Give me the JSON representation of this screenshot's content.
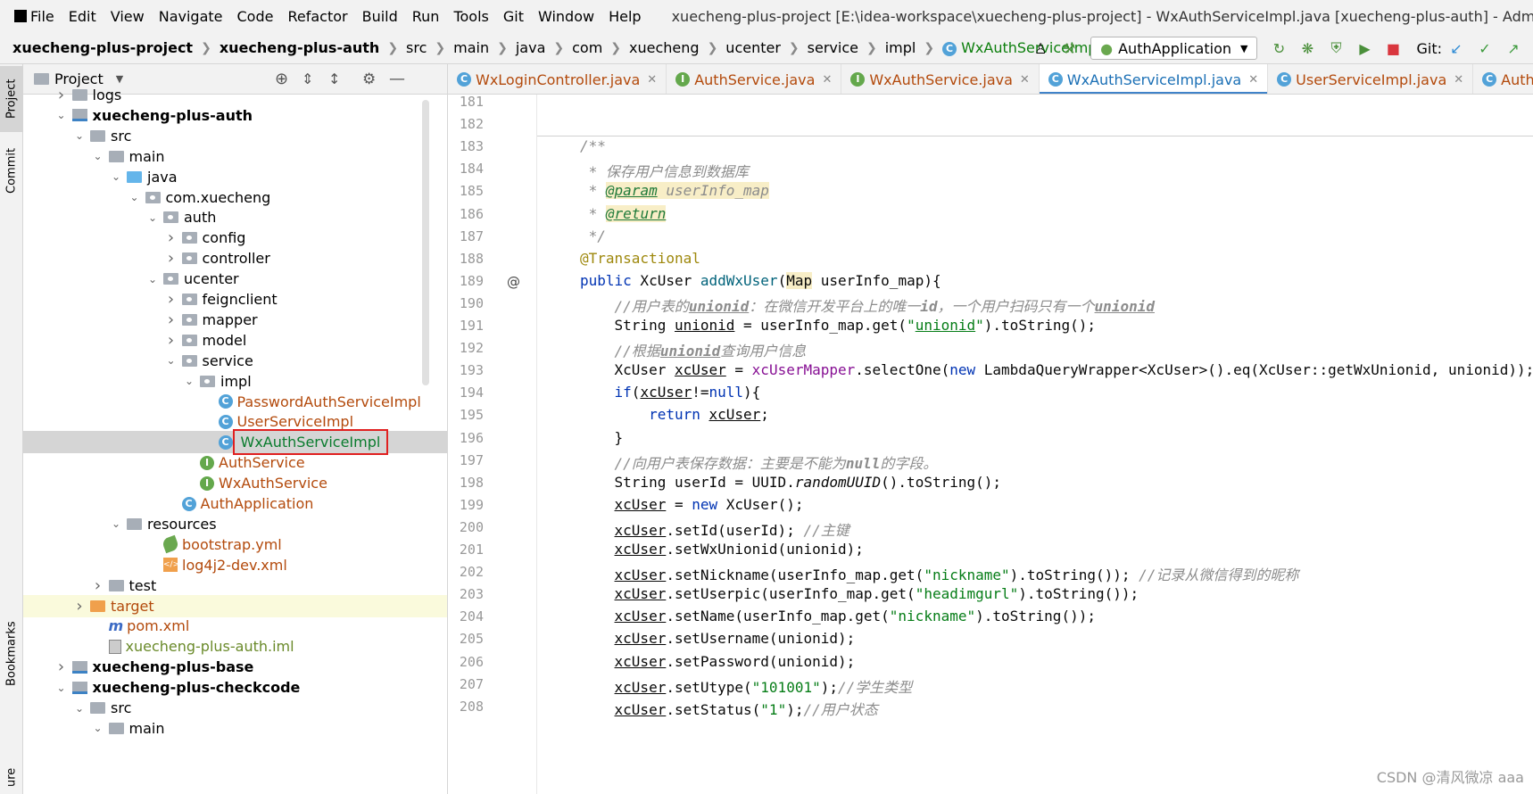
{
  "menubar": {
    "items": [
      "File",
      "Edit",
      "View",
      "Navigate",
      "Code",
      "Refactor",
      "Build",
      "Run",
      "Tools",
      "Git",
      "Window",
      "Help"
    ],
    "title": "xuecheng-plus-project [E:\\idea-workspace\\xuecheng-plus-project] - WxAuthServiceImpl.java [xuecheng-plus-auth] - Administrator"
  },
  "breadcrumb": [
    "xuecheng-plus-project",
    "xuecheng-plus-auth",
    "src",
    "main",
    "java",
    "com",
    "xuecheng",
    "ucenter",
    "service",
    "impl",
    "WxAuthServiceImpl"
  ],
  "toolbar": {
    "run_config": "AuthApplication",
    "git_label": "Git:"
  },
  "side_tabs": {
    "project": "Project",
    "commit": "Commit",
    "bookmarks": "Bookmarks",
    "structure": "ure"
  },
  "project_panel": {
    "title": "Project",
    "tree": [
      {
        "label": "logs",
        "depth": 1,
        "kind": "folder",
        "arrow": ">"
      },
      {
        "label": "xuecheng-plus-auth",
        "depth": 1,
        "kind": "module",
        "arrow": "v"
      },
      {
        "label": "src",
        "depth": 2,
        "kind": "folder",
        "arrow": "v"
      },
      {
        "label": "main",
        "depth": 3,
        "kind": "folder",
        "arrow": "v"
      },
      {
        "label": "java",
        "depth": 4,
        "kind": "srcfolder",
        "arrow": "v"
      },
      {
        "label": "com.xuecheng",
        "depth": 5,
        "kind": "package",
        "arrow": "v"
      },
      {
        "label": "auth",
        "depth": 6,
        "kind": "package",
        "arrow": "v"
      },
      {
        "label": "config",
        "depth": 7,
        "kind": "package",
        "arrow": ">"
      },
      {
        "label": "controller",
        "depth": 7,
        "kind": "package",
        "arrow": ">"
      },
      {
        "label": "ucenter",
        "depth": 6,
        "kind": "package",
        "arrow": "v"
      },
      {
        "label": "feignclient",
        "depth": 7,
        "kind": "package",
        "arrow": ">"
      },
      {
        "label": "mapper",
        "depth": 7,
        "kind": "package",
        "arrow": ">"
      },
      {
        "label": "model",
        "depth": 7,
        "kind": "package",
        "arrow": ">"
      },
      {
        "label": "service",
        "depth": 7,
        "kind": "package",
        "arrow": "v"
      },
      {
        "label": "impl",
        "depth": 8,
        "kind": "package",
        "arrow": "v"
      },
      {
        "label": "PasswordAuthServiceImpl",
        "depth": 9,
        "kind": "class"
      },
      {
        "label": "UserServiceImpl",
        "depth": 9,
        "kind": "class"
      },
      {
        "label": "WxAuthServiceImpl",
        "depth": 9,
        "kind": "class",
        "selected": true
      },
      {
        "label": "AuthService",
        "depth": 8,
        "kind": "interface"
      },
      {
        "label": "WxAuthService",
        "depth": 8,
        "kind": "interface"
      },
      {
        "label": "AuthApplication",
        "depth": 7,
        "kind": "appclass"
      },
      {
        "label": "resources",
        "depth": 4,
        "kind": "resfolder",
        "arrow": "v"
      },
      {
        "label": "bootstrap.yml",
        "depth": 6,
        "kind": "yml"
      },
      {
        "label": "log4j2-dev.xml",
        "depth": 6,
        "kind": "xml"
      },
      {
        "label": "test",
        "depth": 3,
        "kind": "folder",
        "arrow": ">"
      },
      {
        "label": "target",
        "depth": 2,
        "kind": "target",
        "arrow": ">"
      },
      {
        "label": "pom.xml",
        "depth": 3,
        "kind": "pom"
      },
      {
        "label": "xuecheng-plus-auth.iml",
        "depth": 3,
        "kind": "iml"
      },
      {
        "label": "xuecheng-plus-base",
        "depth": 1,
        "kind": "module",
        "arrow": ">"
      },
      {
        "label": "xuecheng-plus-checkcode",
        "depth": 1,
        "kind": "module",
        "arrow": "v"
      },
      {
        "label": "src",
        "depth": 2,
        "kind": "folder",
        "arrow": "v"
      },
      {
        "label": "main",
        "depth": 3,
        "kind": "folder",
        "arrow": "v"
      }
    ]
  },
  "tabs": [
    {
      "label": "WxLoginController.java",
      "kind": "class"
    },
    {
      "label": "AuthService.java",
      "kind": "interface"
    },
    {
      "label": "WxAuthService.java",
      "kind": "interface"
    },
    {
      "label": "WxAuthServiceImpl.java",
      "kind": "class",
      "active": true
    },
    {
      "label": "UserServiceImpl.java",
      "kind": "class"
    },
    {
      "label": "AuthApplication",
      "kind": "class"
    }
  ],
  "editor": {
    "lines": [
      {
        "n": "181",
        "html": ""
      },
      {
        "n": "182",
        "html": ""
      },
      {
        "n": "183",
        "html": "<span class='cm'>/**</span>"
      },
      {
        "n": "184",
        "html": "<span class='cm'> * 保存用户信息到数据库</span>"
      },
      {
        "n": "185",
        "html": "<span class='cm'> * </span><span class='tag'>@param</span><span class='cm brk'> userInfo_map</span>"
      },
      {
        "n": "186",
        "html": "<span class='cm'> * </span><span class='tag'>@return</span>"
      },
      {
        "n": "187",
        "html": "<span class='cm'> */</span>"
      },
      {
        "n": "188",
        "html": "<span class='an'>@Transactional</span>"
      },
      {
        "n": "189",
        "html": "<span class='kw'>public</span> XcUser <span class='fn'>addWxUser</span>(<span class='brk'>Map</span> userInfo_map){"
      },
      {
        "n": "190",
        "html": "    <span class='cmt'>//用户表的<b class='ul'>unionid</b>：在微信开发平台上的唯一<b>id</b>，一个用户扫码只有一个<b class='ul'>unionid</b></span>"
      },
      {
        "n": "191",
        "html": "    String <span class='ul'>unionid</span> = userInfo_map.get(<span class='str'>\"<span class='ul'>unionid</span>\"</span>).toString();"
      },
      {
        "n": "192",
        "html": "    <span class='cmt'>//根据<b class='ul'>unionid</b>查询用户信息</span>"
      },
      {
        "n": "193",
        "html": "    XcUser <span class='ul'>xcUser</span> = <span class='fld'>xcUserMapper</span>.selectOne(<span class='kw'>new</span> LambdaQueryWrapper&lt;XcUser&gt;().eq(XcUser::getWxUnionid, unionid));"
      },
      {
        "n": "194",
        "html": "    <span class='kw'>if</span>(<span class='ul'>xcUser</span>!=<span class='kw'>null</span>){"
      },
      {
        "n": "195",
        "html": "        <span class='kw'>return</span> <span class='ul'>xcUser</span>;"
      },
      {
        "n": "196",
        "html": "    }"
      },
      {
        "n": "197",
        "html": "    <span class='cmt'>//向用户表保存数据：主要是不能为<b>null</b>的字段。</span>"
      },
      {
        "n": "198",
        "html": "    String userId = UUID.<span class='it'>randomUUID</span>().toString();"
      },
      {
        "n": "199",
        "html": "    <span class='ul'>xcUser</span> = <span class='kw'>new</span> XcUser();"
      },
      {
        "n": "200",
        "html": "    <span class='ul'>xcUser</span>.setId(userId); <span class='cmt'>//主键</span>"
      },
      {
        "n": "201",
        "html": "    <span class='ul'>xcUser</span>.setWxUnionid(unionid);"
      },
      {
        "n": "202",
        "html": "    <span class='ul'>xcUser</span>.setNickname(userInfo_map.get(<span class='str'>\"nickname\"</span>).toString()); <span class='cmt'>//记录从微信得到的昵称</span>"
      },
      {
        "n": "203",
        "html": "    <span class='ul'>xcUser</span>.setUserpic(userInfo_map.get(<span class='str'>\"headimgurl\"</span>).toString());"
      },
      {
        "n": "204",
        "html": "    <span class='ul'>xcUser</span>.setName(userInfo_map.get(<span class='str'>\"nickname\"</span>).toString());"
      },
      {
        "n": "205",
        "html": "    <span class='ul'>xcUser</span>.setUsername(unionid);"
      },
      {
        "n": "206",
        "html": "    <span class='ul'>xcUser</span>.setPassword(unionid);"
      },
      {
        "n": "207",
        "html": "    <span class='ul'>xcUser</span>.setUtype(<span class='str'>\"101001\"</span>);<span class='cmt'>//学生类型</span>"
      },
      {
        "n": "208",
        "html": "    <span class='ul'>xcUser</span>.setStatus(<span class='str'>\"1\"</span>);<span class='cmt'>//用户状态</span>"
      }
    ]
  },
  "watermark": "CSDN @清风微凉 aaa",
  "colors": {
    "highlight_box": "#e02020",
    "active_tab_underline": "#4083c9"
  }
}
